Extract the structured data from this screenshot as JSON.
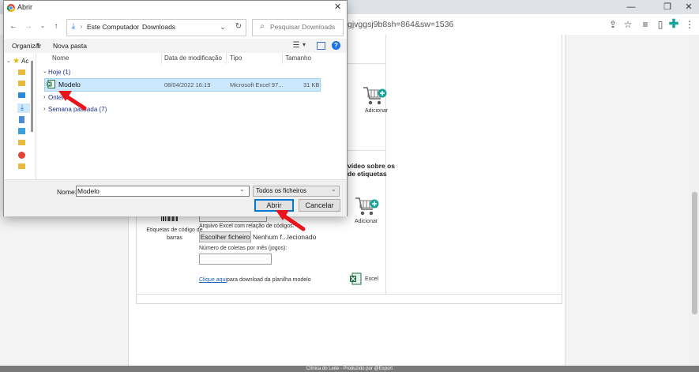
{
  "browser": {
    "url_fragment": "gjvggsj9b8sh=864&sw=1536",
    "controls": {
      "minimize": "—",
      "restore": "❐",
      "close": "✕"
    }
  },
  "page": {
    "video_text_1": "vídeo sobre os",
    "video_text_2": "de etiquetas",
    "add_label_1": "Adicionar",
    "add_label_2": "Adicionar",
    "barcode_label_1": "Etiquetas de código de",
    "barcode_label_2": "barras",
    "excel_file_label": "Arquivo Excel com relação de códigos:",
    "choose_file_button": "Escolher ficheiro",
    "no_file_text": "Nenhum f...lecionado",
    "monthly_label": "Número de coletas por mês (jogos):",
    "download_link": "Clique aqui",
    "download_suffix": "para download da planilha modelo",
    "excel_label": "Excel",
    "footer_text": "Clínica do Leite - Produzido por @Export"
  },
  "dialog": {
    "title": "Abrir",
    "breadcrumb": [
      "Este Computador",
      "Downloads"
    ],
    "search_placeholder": "Pesquisar Downloads",
    "organize": "Organizar",
    "new_folder": "Nova pasta",
    "columns": [
      "Nome",
      "Data de modificação",
      "Tipo",
      "Tamanho"
    ],
    "groups": [
      {
        "label": "Hoje (1)"
      },
      {
        "label": "Ontem"
      },
      {
        "label": "Semana passada (7)"
      }
    ],
    "file": {
      "name": "Modelo",
      "date": "08/04/2022 16:19",
      "type": "Microsoft Excel 97...",
      "size": "31 KB"
    },
    "name_label": "Nome:",
    "name_value": "Modelo",
    "filter_value": "Todos os ficheiros",
    "open_button": "Abrir",
    "cancel_button": "Cancelar",
    "nav_quick_access": "Ac"
  },
  "colors": {
    "arrow": "#e8141b",
    "selection": "#cce8ff",
    "excel_green": "#1d6f42",
    "cart_teal": "#1aa39a"
  }
}
